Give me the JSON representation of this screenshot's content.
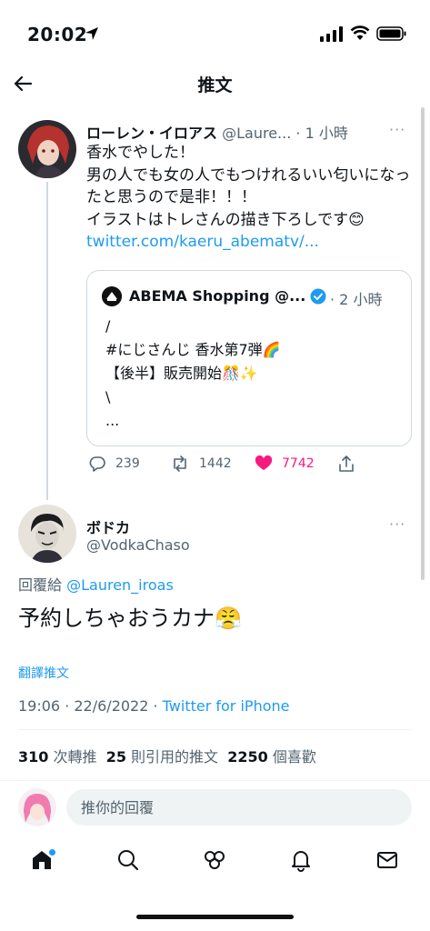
{
  "status": {
    "time": "20:02"
  },
  "header": {
    "title": "推文"
  },
  "main_tweet": {
    "name": "ローレン・イロアス",
    "handle": "@Laure...",
    "time": "· 1 小時",
    "text": "香水でやした！\n男の人でも女の人でもつけれるいい匂いになったと思うので是非！！！\nイラストはトレさんの描き下ろしです😊",
    "link": "twitter.com/kaeru_abematv/...",
    "quote": {
      "name": "ABEMA Shopping @...",
      "time": "· 2 小時",
      "text": "/\n#にじさんじ 香水第7弾🌈\n【後半】販売開始🎊✨\n\\\n..."
    },
    "actions": {
      "replies": "239",
      "retweets": "1442",
      "likes": "7742"
    }
  },
  "reply_tweet": {
    "name": "ボドカ",
    "handle": "@VodkaChaso",
    "reply_to_label": "回覆給",
    "reply_to_handle": "@Lauren_iroas",
    "text": "予約しちゃおうカナ😤",
    "translate": "翻譯推文",
    "timestamp": "19:06 · 22/6/2022 · ",
    "source": "Twitter for iPhone",
    "stats": {
      "retweets": "310",
      "retweets_label": "次轉推",
      "quotes": "25",
      "quotes_label": "則引用的推文",
      "likes": "2250",
      "likes_label": "個喜歡"
    }
  },
  "composer": {
    "placeholder": "推你的回覆"
  },
  "colors": {
    "accent": "#1d9bf0",
    "like": "#f91880",
    "muted": "#536471"
  }
}
